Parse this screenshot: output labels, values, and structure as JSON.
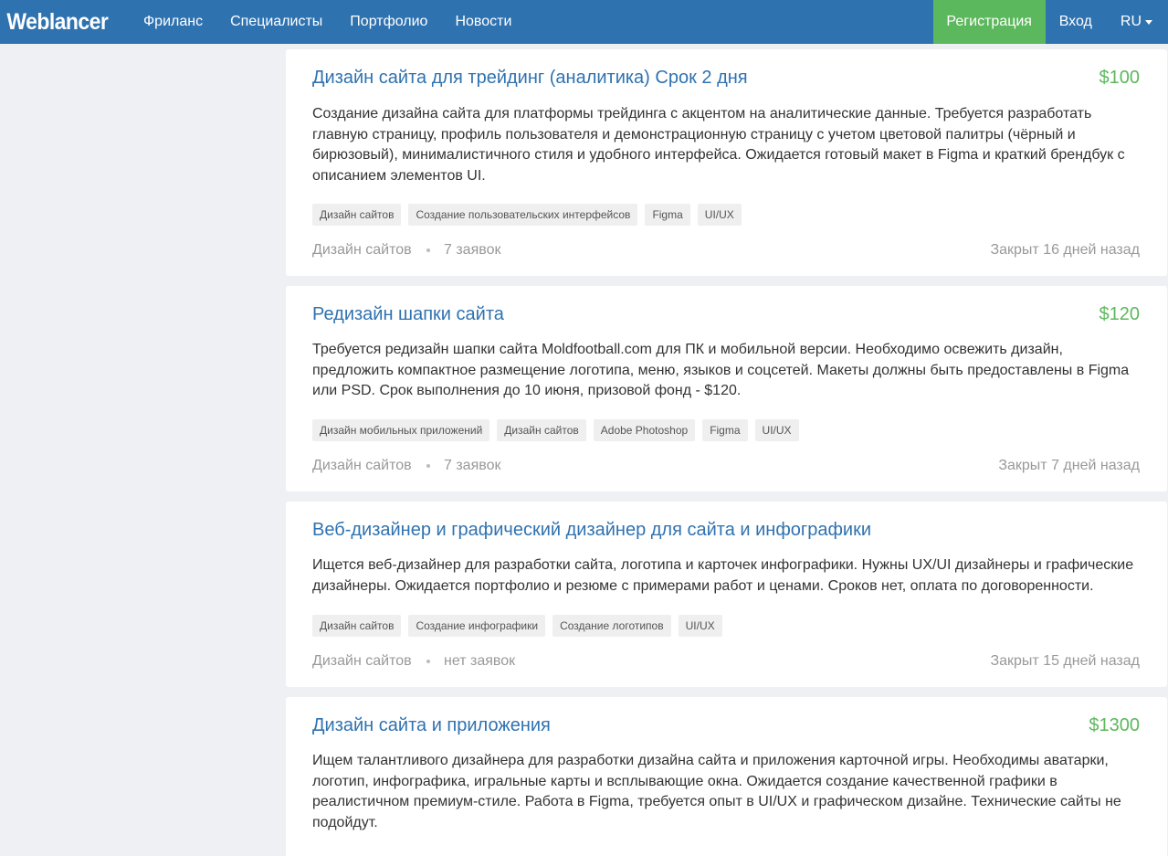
{
  "header": {
    "logo": "Weblancer",
    "nav": [
      "Фриланс",
      "Специалисты",
      "Портфолио",
      "Новости"
    ],
    "register": "Регистрация",
    "login": "Вход",
    "lang": "RU"
  },
  "jobs": [
    {
      "title": "Дизайн сайта для трейдинг (аналитика) Срок 2 дня",
      "price": "$100",
      "description": "Создание дизайна сайта для платформы трейдинга с акцентом на аналитические данные. Требуется разработать главную страницу, профиль пользователя и демонстрационную страницу с учетом цветовой палитры (чёрный и бирюзовый), минималистичного стиля и удобного интерфейса. Ожидается готовый макет в Figma и краткий брендбук с описанием элементов UI.",
      "tags": [
        "Дизайн сайтов",
        "Создание пользовательских интерфейсов",
        "Figma",
        "UI/UX"
      ],
      "category": "Дизайн сайтов",
      "bids": "7 заявок",
      "closed": "Закрыт 16 дней назад"
    },
    {
      "title": "Редизайн шапки сайта",
      "price": "$120",
      "description": "Требуется редизайн шапки сайта Moldfootball.com для ПК и мобильной версии. Необходимо освежить дизайн, предложить компактное размещение логотипа, меню, языков и соцсетей. Макеты должны быть предоставлены в Figma или PSD. Срок выполнения до 10 июня, призовой фонд - $120.",
      "tags": [
        "Дизайн мобильных приложений",
        "Дизайн сайтов",
        "Adobe Photoshop",
        "Figma",
        "UI/UX"
      ],
      "category": "Дизайн сайтов",
      "bids": "7 заявок",
      "closed": "Закрыт 7 дней назад"
    },
    {
      "title": "Веб-дизайнер и графический дизайнер для сайта и инфографики",
      "price": "",
      "description": "Ищется веб-дизайнер для разработки сайта, логотипа и карточек инфографики. Нужны UX/UI дизайнеры и графические дизайнеры. Ожидается портфолио и резюме с примерами работ и ценами. Сроков нет, оплата по договоренности.",
      "tags": [
        "Дизайн сайтов",
        "Создание инфографики",
        "Создание логотипов",
        "UI/UX"
      ],
      "category": "Дизайн сайтов",
      "bids": "нет заявок",
      "closed": "Закрыт 15 дней назад"
    },
    {
      "title": "Дизайн сайта и приложения",
      "price": "$1300",
      "description": "Ищем талантливого дизайнера для разработки дизайна сайта и приложения карточной игры. Необходимы аватарки, логотип, инфографика, игральные карты и всплывающие окна. Ожидается создание качественной графики в реалистичном премиум-стиле. Работа в Figma, требуется опыт в UI/UX и графическом дизайне. Технические сайты не подойдут.",
      "tags": [],
      "category": "",
      "bids": "",
      "closed": ""
    }
  ]
}
